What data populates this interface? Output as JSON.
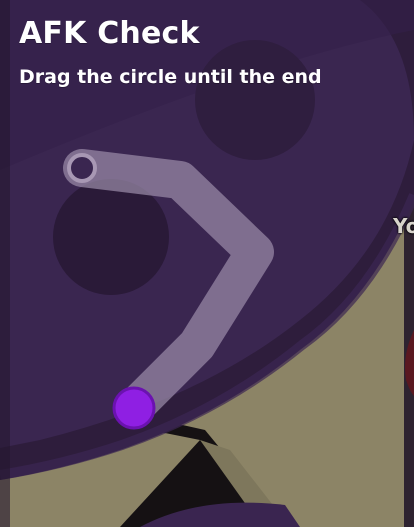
{
  "modal": {
    "title": "AFK Check",
    "instruction": "Drag the circle until the end"
  },
  "background": {
    "partial_player_name": "Yo"
  },
  "drag_path": {
    "progress": 0
  },
  "colors": {
    "arena": "#2e1d3c",
    "arena_rim": "#3a2550",
    "ground": "#8c8466",
    "path": "#9a8aa8",
    "handle": "#8f1fe3",
    "handle_border": "#6b12b0"
  },
  "icons": {
    "handle": "drag-handle-circle",
    "end_marker": "hollow-end-circle"
  }
}
